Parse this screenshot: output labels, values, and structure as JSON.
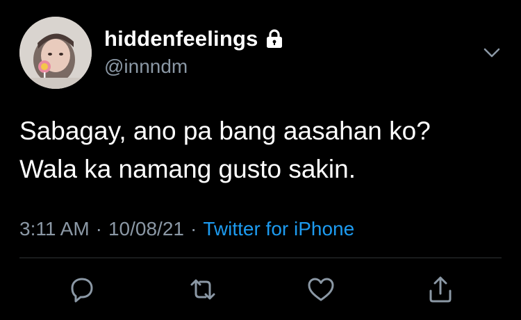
{
  "tweet": {
    "author": {
      "display_name": "hiddenfeelings",
      "handle": "@innndm",
      "protected_icon": "lock-icon",
      "avatar": "child-holding-lollipop-photo"
    },
    "text_lines": [
      "Sabagay, ano pa bang aasahan ko?",
      "Wala ka namang gusto sakin."
    ],
    "time": "3:11 AM",
    "date": "10/08/21",
    "separator": "·",
    "source": "Twitter for iPhone"
  },
  "actions": [
    {
      "name": "reply",
      "icon": "reply-icon"
    },
    {
      "name": "retweet",
      "icon": "retweet-icon"
    },
    {
      "name": "like",
      "icon": "heart-icon"
    },
    {
      "name": "share",
      "icon": "share-icon"
    }
  ],
  "colors": {
    "background": "#000000",
    "primary_text": "#ffffff",
    "secondary_text": "#8b98a5",
    "link": "#1d9bf0",
    "divider": "#2f3336"
  }
}
